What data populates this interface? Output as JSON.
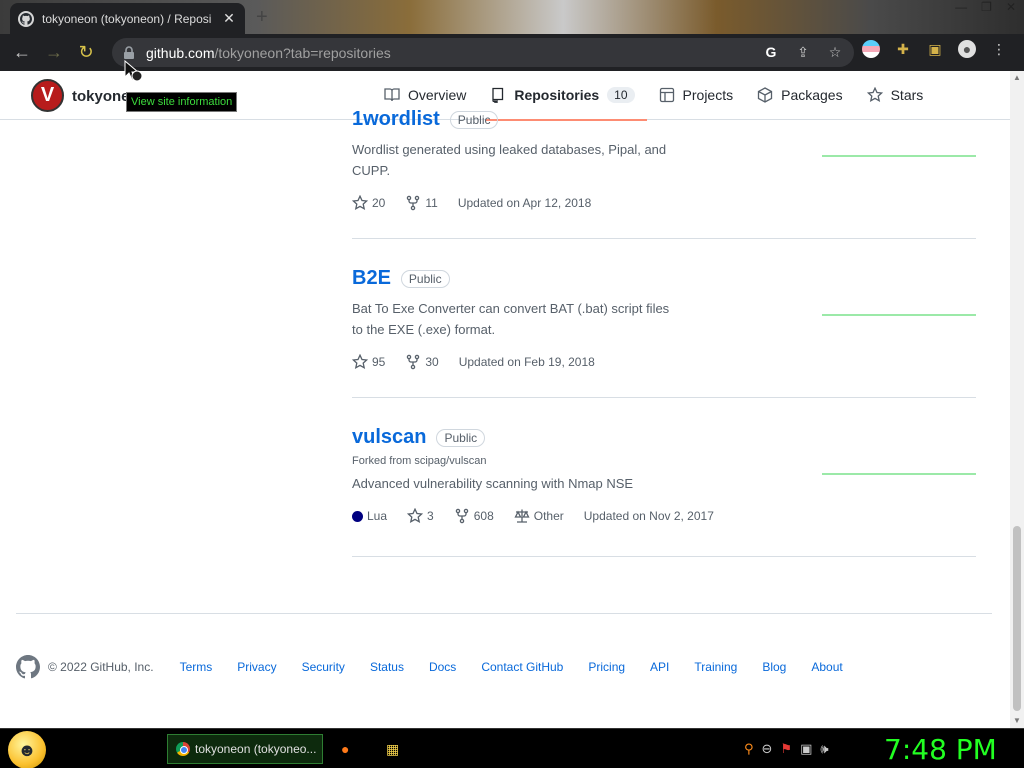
{
  "browser": {
    "tab_title": "tokyoneon (tokyoneon) / Reposi",
    "tab_close": "✕",
    "new_tab": "+",
    "url_host": "github.com",
    "url_rest": "/tokyoneon?tab=repositories",
    "tooltip": "View site information"
  },
  "profile": {
    "avatar_letter": "V",
    "username": "tokyoneo"
  },
  "nav": [
    {
      "label": "Overview"
    },
    {
      "label": "Repositories",
      "count": "10"
    },
    {
      "label": "Projects"
    },
    {
      "label": "Packages"
    },
    {
      "label": "Stars"
    }
  ],
  "repos": [
    {
      "name": "1wordlist",
      "badge": "Public",
      "description": "Wordlist generated using leaked databases, Pipal, and CUPP.",
      "stars": "20",
      "forks": "11",
      "updated": "Updated on Apr 12, 2018"
    },
    {
      "name": "B2E",
      "badge": "Public",
      "description": "Bat To Exe Converter can convert BAT (.bat) script files to the EXE (.exe) format.",
      "stars": "95",
      "forks": "30",
      "updated": "Updated on Feb 19, 2018"
    },
    {
      "name": "vulscan",
      "badge": "Public",
      "forked_from": "Forked from scipag/vulscan",
      "description": "Advanced vulnerability scanning with Nmap NSE",
      "language": "Lua",
      "language_color": "#000080",
      "stars": "3",
      "forks": "608",
      "license": "Other",
      "updated": "Updated on Nov 2, 2017"
    }
  ],
  "footer": {
    "copyright": "© 2022 GitHub, Inc.",
    "links": [
      "Terms",
      "Privacy",
      "Security",
      "Status",
      "Docs",
      "Contact GitHub",
      "Pricing",
      "API",
      "Training",
      "Blog",
      "About"
    ]
  },
  "taskbar": {
    "task_label": "tokyoneon (tokyoneo...",
    "clock": "7:48 PM"
  },
  "colors": {
    "link": "#0969da",
    "active_underline": "#fd8c73",
    "clock": "#22ff22"
  }
}
